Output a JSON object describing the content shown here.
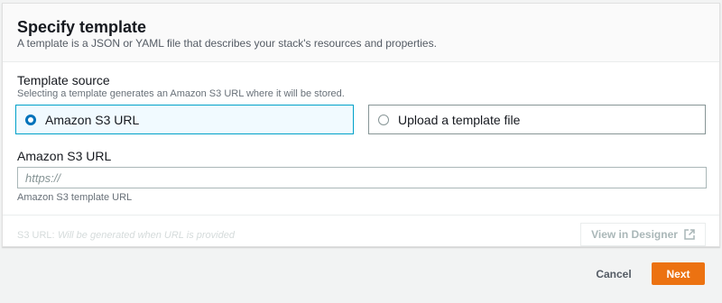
{
  "panel": {
    "title": "Specify template",
    "description": "A template is a JSON or YAML file that describes your stack's resources and properties."
  },
  "template_source": {
    "label": "Template source",
    "description": "Selecting a template generates an Amazon S3 URL where it will be stored.",
    "options": [
      {
        "label": "Amazon S3 URL",
        "selected": true
      },
      {
        "label": "Upload a template file",
        "selected": false
      }
    ]
  },
  "s3_url_field": {
    "label": "Amazon S3 URL",
    "placeholder": "https://",
    "value": "",
    "hint": "Amazon S3 template URL"
  },
  "s3_url_footer": {
    "label": "S3 URL:",
    "value": "Will be generated when URL is provided"
  },
  "designer_button": {
    "label": "View in Designer",
    "icon": "external-link-icon"
  },
  "actions": {
    "cancel": "Cancel",
    "next": "Next"
  },
  "colors": {
    "accent": "#ec7211",
    "selected_border": "#00a1c9",
    "radio": "#0073bb"
  }
}
